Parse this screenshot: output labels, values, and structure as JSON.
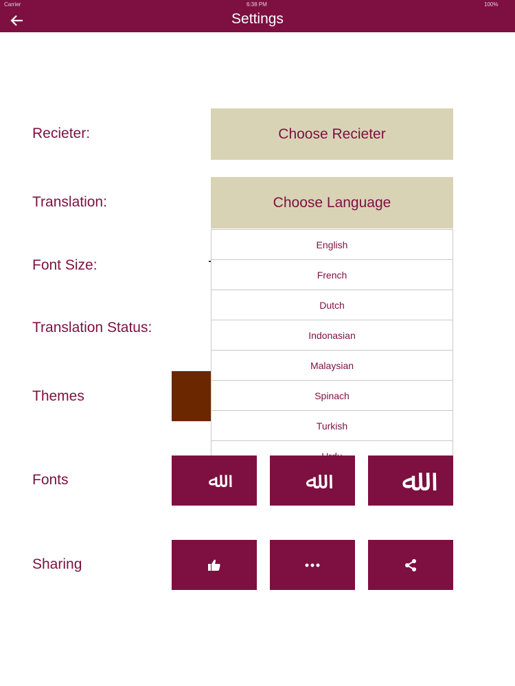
{
  "status_bar": {
    "carrier": "Carrier",
    "time": "6:38 PM",
    "battery": "100%"
  },
  "header": {
    "title": "Settings",
    "back_icon": "arrow-left-icon"
  },
  "rows": {
    "reciter_label": "Recieter:",
    "translation_label": "Translation:",
    "font_size_label": "Font Size:",
    "translation_status_label": "Translation Status:",
    "themes_label": "Themes",
    "fonts_label": "Fonts",
    "sharing_label": "Sharing"
  },
  "buttons": {
    "choose_reciter": "Choose Recieter",
    "choose_language": "Choose Language"
  },
  "language_options": [
    "English",
    "French",
    "Dutch",
    "Indonasian",
    "Malaysian",
    "Spinach",
    "Turkish",
    "Urdu"
  ],
  "fonts": [
    {
      "glyph": "ﷲ"
    },
    {
      "glyph": "ﷲ"
    },
    {
      "glyph": "ﷲ"
    }
  ],
  "sharing_icons": [
    "thumbs-up-icon",
    "more-dots-icon",
    "share-icon"
  ],
  "colors": {
    "primary": "#7d1040",
    "button_bg": "#d9d3b5",
    "theme_swatch": "#6b2700"
  }
}
